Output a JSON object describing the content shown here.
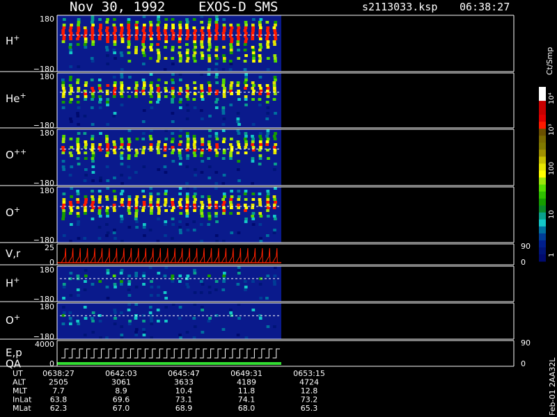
{
  "header": {
    "date": "Nov 30, 1992",
    "instrument": "EXOS-D SMS",
    "filename": "s2113033.ksp",
    "time": "06:38:27"
  },
  "colorbar": {
    "unit": "Ct/Smp",
    "labels": [
      "10⁴",
      "10³",
      "100",
      "10",
      "1"
    ],
    "colors": [
      "#ffffff",
      "#ffffff",
      "#c80000",
      "#c80000",
      "#e00000",
      "#ff1a00",
      "#6b5000",
      "#7a6a00",
      "#807800",
      "#a09000",
      "#c8c000",
      "#e6e600",
      "#ffff00",
      "#9be60a",
      "#55dc00",
      "#2fbf00",
      "#169e00",
      "#0a8a2a",
      "#0aa08c",
      "#14c8c8",
      "#0070a0",
      "#003c96",
      "#001e8c",
      "#001478",
      "#000a6e"
    ]
  },
  "panels": [
    {
      "label": "H",
      "sup": "+",
      "ymax": "180",
      "ymin": "−180"
    },
    {
      "label": "He",
      "sup": "+",
      "ymax": "180",
      "ymin": "−180"
    },
    {
      "label": "O",
      "sup": "++",
      "ymax": "180",
      "ymin": "−180"
    },
    {
      "label": "O",
      "sup": "+",
      "ymax": "180",
      "ymin": "−180"
    },
    {
      "label": "V,r",
      "ymax": "25",
      "ymin": "0",
      "rtop": "90",
      "rbot": "0"
    },
    {
      "label": "H",
      "sup": "+",
      "ymax": "180",
      "ymin": "−180"
    },
    {
      "label": "O",
      "sup": "+",
      "ymax": "180",
      "ymin": "−180"
    },
    {
      "label": "E,p",
      "label2": "QA",
      "ymax": "4000",
      "ymin": "0",
      "rtop": "90",
      "rbot": "0"
    }
  ],
  "side_label": "Feb-01 2AA32L",
  "ephemeris": {
    "row_labels": [
      "UT",
      "ALT",
      "MLT",
      "InLat",
      "MLat"
    ],
    "columns": [
      {
        "UT": "0638:27",
        "ALT": "2505",
        "MLT": "7.7",
        "InLat": "63.8",
        "MLat": "62.3"
      },
      {
        "UT": "0642:03",
        "ALT": "3061",
        "MLT": "8.9",
        "InLat": "69.6",
        "MLat": "67.0"
      },
      {
        "UT": "0645:47",
        "ALT": "3633",
        "MLT": "10.4",
        "InLat": "73.1",
        "MLat": "68.9"
      },
      {
        "UT": "0649:31",
        "ALT": "4189",
        "MLT": "11.8",
        "InLat": "74.1",
        "MLat": "68.0"
      },
      {
        "UT": "0653:15",
        "ALT": "4724",
        "MLT": "12.8",
        "InLat": "73.2",
        "MLat": "65.3"
      }
    ]
  },
  "chart_data": {
    "type": "heatmap",
    "title": "Nov 30, 1992   EXOS-D SMS",
    "x": [
      "0638:27",
      "0642:03",
      "0645:47",
      "0649:31",
      "0653:15"
    ],
    "spin_count": 30,
    "data_end_fraction": 0.5,
    "zlabel": "Ct/Smp",
    "zscale": "log",
    "zrange": [
      1,
      10000
    ],
    "grid": false
  }
}
